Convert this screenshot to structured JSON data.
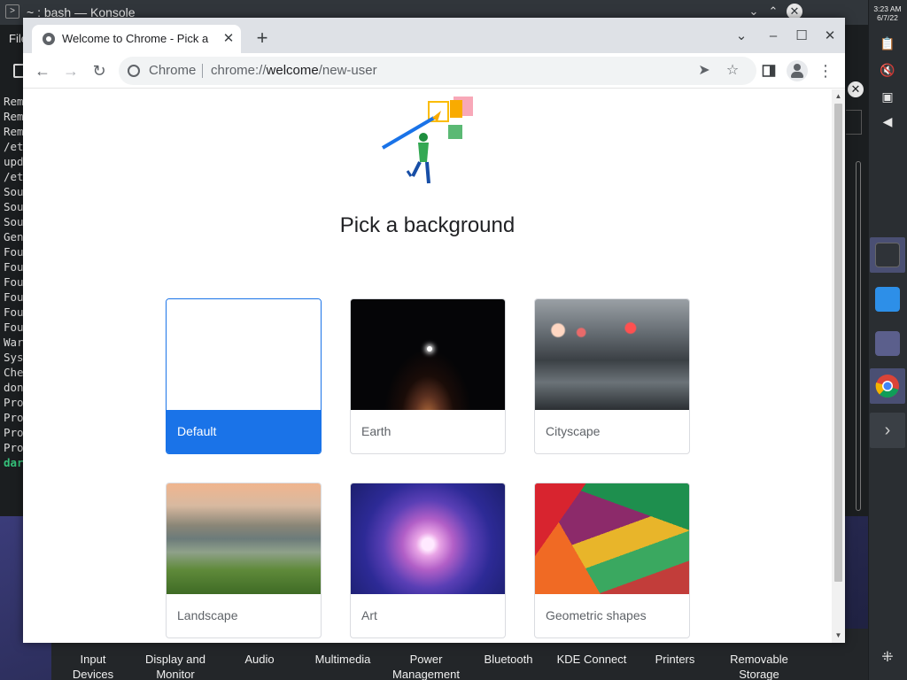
{
  "desktop": {
    "konsole_title": "~ : bash — Konsole",
    "konsole_menu_partial": "File",
    "konsole_line_prefixes": [
      "Rem",
      "Rem",
      "Rem",
      "/et",
      "upd",
      "/et",
      "Sou",
      "Sou",
      "Sou",
      "Gen",
      "Fou",
      "Fou",
      "Fou",
      "Fou",
      "Fou",
      "Fou",
      "War",
      "Sys",
      "Che",
      "don",
      "Pro",
      "Pro",
      "Pro",
      "Pro",
      "dar"
    ],
    "kde_settings_items": [
      {
        "label": "Input\nDevices"
      },
      {
        "label": "Display and\nMonitor"
      },
      {
        "label": "Audio"
      },
      {
        "label": "Multimedia"
      },
      {
        "label": "Power\nManagement"
      },
      {
        "label": "Bluetooth"
      },
      {
        "label": "KDE Connect"
      },
      {
        "label": "Printers"
      },
      {
        "label": "Removable\nStorage"
      }
    ]
  },
  "panel": {
    "time": "3:23 AM",
    "date": "6/7/22"
  },
  "chrome": {
    "tab_title": "Welcome to Chrome - Pick a b",
    "omnibox": {
      "chip": "Chrome",
      "url_scheme": "chrome://",
      "url_host": "welcome",
      "url_path": "/new-user"
    },
    "page": {
      "title": "Pick a background",
      "backgrounds": [
        {
          "label": "Default",
          "selected": true
        },
        {
          "label": "Earth",
          "selected": false
        },
        {
          "label": "Cityscape",
          "selected": false
        },
        {
          "label": "Landscape",
          "selected": false
        },
        {
          "label": "Art",
          "selected": false
        },
        {
          "label": "Geometric shapes",
          "selected": false
        }
      ]
    },
    "colors": {
      "accent": "#1a73e8",
      "tabstrip": "#dee1e6"
    }
  },
  "icons": {
    "back": "arrow-left-icon",
    "forward": "arrow-right-icon",
    "reload": "reload-icon",
    "send": "send-icon",
    "bookmark": "star-icon",
    "side_panel": "side-panel-icon",
    "profile": "avatar-icon",
    "menu": "kebab-menu-icon"
  }
}
